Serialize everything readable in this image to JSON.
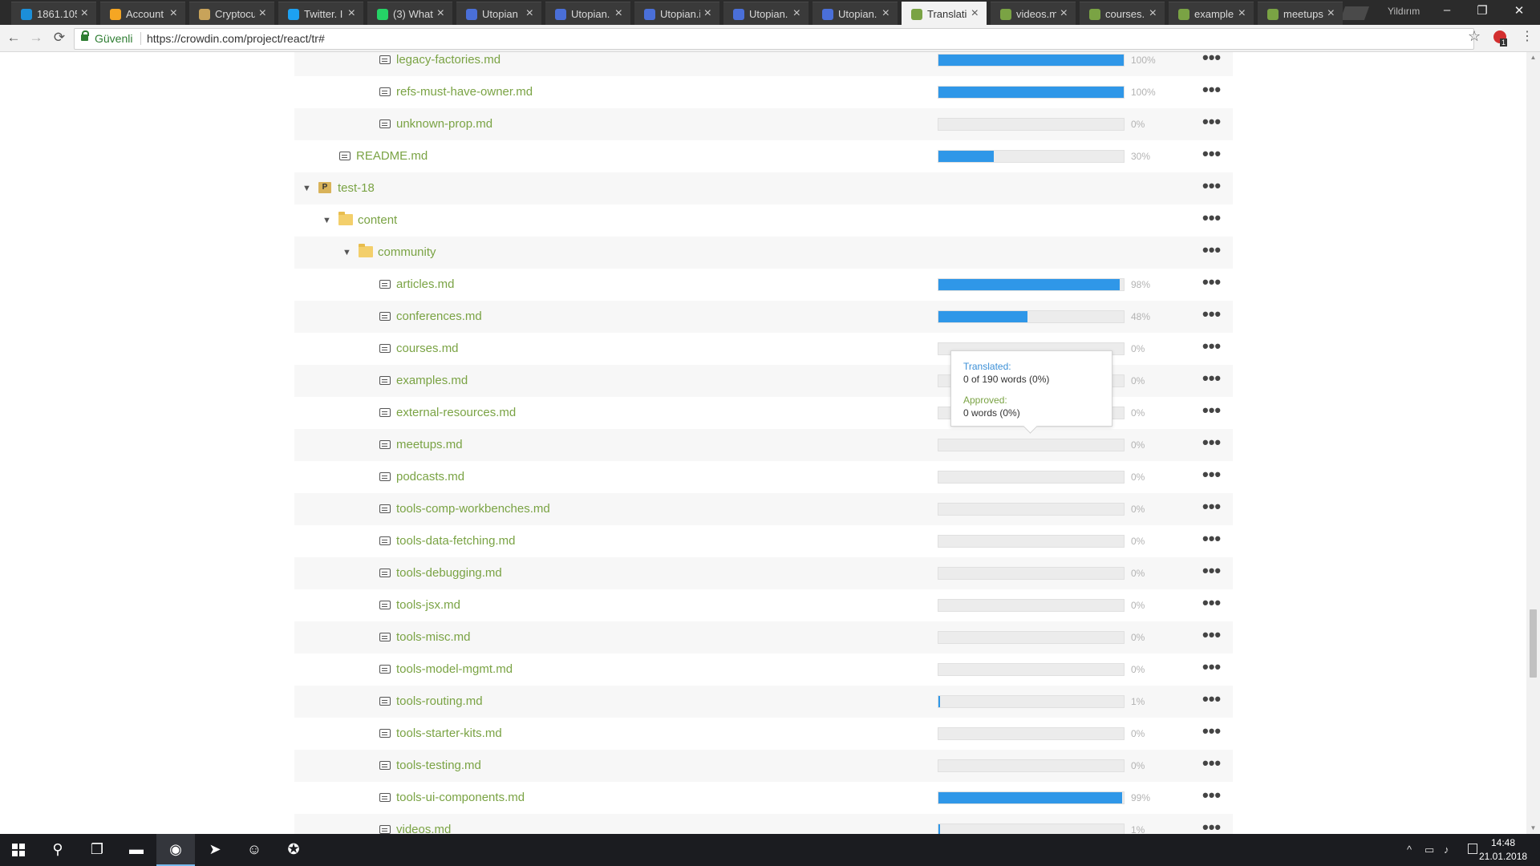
{
  "browser": {
    "tabs": [
      {
        "title": "1861.105",
        "icon": "x-icon",
        "color": "#1c8fd9",
        "active": false
      },
      {
        "title": "Account",
        "icon": "bitcoin-icon",
        "color": "#f5a623",
        "active": false
      },
      {
        "title": "Cryptocu",
        "icon": "coin-icon",
        "color": "#c8a35a",
        "active": false
      },
      {
        "title": "Twitter. I",
        "icon": "twitter-icon",
        "color": "#1da1f2",
        "active": false
      },
      {
        "title": "(3) What",
        "icon": "whatsapp-icon",
        "color": "#25d366",
        "active": false
      },
      {
        "title": "Utopian",
        "icon": "utopian-icon",
        "color": "#4a6fd8",
        "active": false
      },
      {
        "title": "Utopian.",
        "icon": "utopian-icon",
        "color": "#4a6fd8",
        "active": false
      },
      {
        "title": "Utopian.i",
        "icon": "utopian-icon",
        "color": "#4a6fd8",
        "active": false
      },
      {
        "title": "Utopian.",
        "icon": "utopian-icon",
        "color": "#4a6fd8",
        "active": false
      },
      {
        "title": "Utopian.",
        "icon": "utopian-icon",
        "color": "#4a6fd8",
        "active": false
      },
      {
        "title": "Translatic",
        "icon": "crowdin-icon",
        "color": "#7aa344",
        "active": true
      },
      {
        "title": "videos.m",
        "icon": "crowdin-icon",
        "color": "#7aa344",
        "active": false
      },
      {
        "title": "courses.n",
        "icon": "crowdin-icon",
        "color": "#7aa344",
        "active": false
      },
      {
        "title": "example:",
        "icon": "crowdin-icon",
        "color": "#7aa344",
        "active": false
      },
      {
        "title": "meetups",
        "icon": "crowdin-icon",
        "color": "#7aa344",
        "active": false
      }
    ],
    "tab_close_glyph": "×",
    "profile_name": "Yildırım",
    "window_controls": {
      "minimize": "–",
      "restore": "❐",
      "close": "✕"
    },
    "nav": {
      "back": "←",
      "forward": "→",
      "reload": "⟳"
    },
    "secure_label": "Güvenli",
    "url": "https://crowdin.com/project/react/tr#",
    "star": "☆",
    "menu": "⋮",
    "extension_badge": "1"
  },
  "rows": [
    {
      "type": "file",
      "indent": 2,
      "name": "legacy-factories.md",
      "progress": 100,
      "pct_label": "100%",
      "shaded": true
    },
    {
      "type": "file",
      "indent": 2,
      "name": "refs-must-have-owner.md",
      "progress": 100,
      "pct_label": "100%",
      "shaded": false
    },
    {
      "type": "file",
      "indent": 2,
      "name": "unknown-prop.md",
      "progress": 0,
      "pct_label": "0%",
      "shaded": true
    },
    {
      "type": "file",
      "indent": 1,
      "name": "README.md",
      "progress": 30,
      "pct_label": "30%",
      "shaded": false
    },
    {
      "type": "project",
      "indent": 0,
      "name": "test-18",
      "shaded": true
    },
    {
      "type": "folder",
      "indent": 1,
      "name": "content",
      "shaded": false
    },
    {
      "type": "folder",
      "indent": 2,
      "name": "community",
      "shaded": true
    },
    {
      "type": "file",
      "indent": 2,
      "name": "articles.md",
      "progress": 98,
      "pct_label": "98%",
      "shaded": false
    },
    {
      "type": "file",
      "indent": 2,
      "name": "conferences.md",
      "progress": 48,
      "pct_label": "48%",
      "shaded": true
    },
    {
      "type": "file",
      "indent": 2,
      "name": "courses.md",
      "progress": 0,
      "pct_label": "0%",
      "shaded": false
    },
    {
      "type": "file",
      "indent": 2,
      "name": "examples.md",
      "progress": 0,
      "pct_label": "0%",
      "shaded": true
    },
    {
      "type": "file",
      "indent": 2,
      "name": "external-resources.md",
      "progress": 0,
      "pct_label": "0%",
      "shaded": false
    },
    {
      "type": "file",
      "indent": 2,
      "name": "meetups.md",
      "progress": 0,
      "pct_label": "0%",
      "shaded": true
    },
    {
      "type": "file",
      "indent": 2,
      "name": "podcasts.md",
      "progress": 0,
      "pct_label": "0%",
      "shaded": false
    },
    {
      "type": "file",
      "indent": 2,
      "name": "tools-comp-workbenches.md",
      "progress": 0,
      "pct_label": "0%",
      "shaded": true
    },
    {
      "type": "file",
      "indent": 2,
      "name": "tools-data-fetching.md",
      "progress": 0,
      "pct_label": "0%",
      "shaded": false
    },
    {
      "type": "file",
      "indent": 2,
      "name": "tools-debugging.md",
      "progress": 0,
      "pct_label": "0%",
      "shaded": true
    },
    {
      "type": "file",
      "indent": 2,
      "name": "tools-jsx.md",
      "progress": 0,
      "pct_label": "0%",
      "shaded": false
    },
    {
      "type": "file",
      "indent": 2,
      "name": "tools-misc.md",
      "progress": 0,
      "pct_label": "0%",
      "shaded": true
    },
    {
      "type": "file",
      "indent": 2,
      "name": "tools-model-mgmt.md",
      "progress": 0,
      "pct_label": "0%",
      "shaded": false
    },
    {
      "type": "file",
      "indent": 2,
      "name": "tools-routing.md",
      "progress": 1,
      "pct_label": "1%",
      "shaded": true
    },
    {
      "type": "file",
      "indent": 2,
      "name": "tools-starter-kits.md",
      "progress": 0,
      "pct_label": "0%",
      "shaded": false
    },
    {
      "type": "file",
      "indent": 2,
      "name": "tools-testing.md",
      "progress": 0,
      "pct_label": "0%",
      "shaded": true
    },
    {
      "type": "file",
      "indent": 2,
      "name": "tools-ui-components.md",
      "progress": 99,
      "pct_label": "99%",
      "shaded": false
    },
    {
      "type": "file",
      "indent": 2,
      "name": "videos.md",
      "progress": 1,
      "pct_label": "1%",
      "shaded": true
    }
  ],
  "row_menu_glyph": "•••",
  "tooltip": {
    "translated_label": "Translated:",
    "translated_value": "0 of 190 words (0%)",
    "approved_label": "Approved:",
    "approved_value": "0 words (0%)"
  },
  "colors": {
    "accent_blue": "#2f97e8",
    "link_green": "#7aa344",
    "translated_label": "#3b8fd6",
    "approved_label": "#7aa344"
  },
  "taskbar": {
    "apps": [
      {
        "name": "search",
        "glyph": "⚲"
      },
      {
        "name": "task-view",
        "glyph": "❐"
      },
      {
        "name": "file-explorer",
        "glyph": "▬"
      },
      {
        "name": "chrome",
        "glyph": "◉"
      },
      {
        "name": "telegram",
        "glyph": "➤"
      },
      {
        "name": "discord",
        "glyph": "☺"
      },
      {
        "name": "steam",
        "glyph": "✪"
      }
    ],
    "tray": {
      "chevron": "^",
      "network": "▭",
      "volume": "♪"
    },
    "time": "14:48",
    "date": "21.01.2018"
  }
}
